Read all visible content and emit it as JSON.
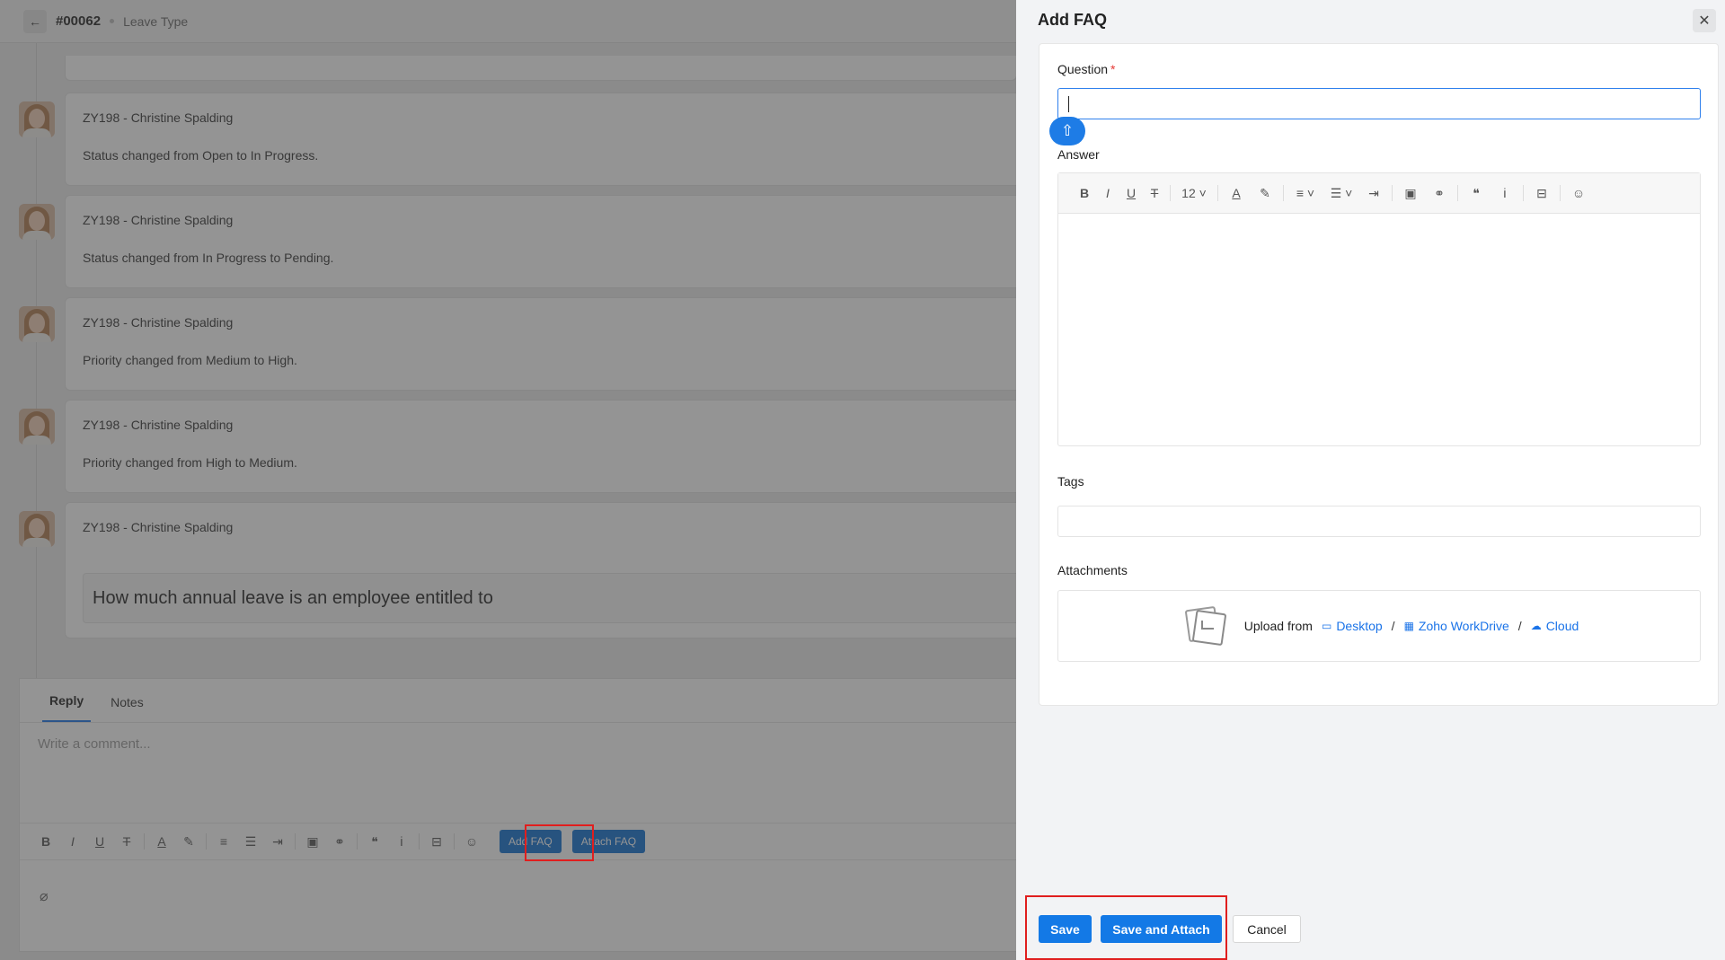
{
  "ticket": {
    "id": "#00062",
    "type": "Leave Type"
  },
  "timeline": [
    {
      "author": "ZY198 - Christine Spalding",
      "message": "Status changed from Open to In Progress."
    },
    {
      "author": "ZY198 - Christine Spalding",
      "message": "Status changed from In Progress to Pending."
    },
    {
      "author": "ZY198 - Christine Spalding",
      "message": "Priority changed from Medium to High."
    },
    {
      "author": "ZY198 - Christine Spalding",
      "message": "Priority changed from High to Medium."
    },
    {
      "author": "ZY198 - Christine Spalding",
      "faq": "How much annual leave is an employee entitled to"
    }
  ],
  "reply": {
    "tabs": [
      "Reply",
      "Notes"
    ],
    "active_tab": "Reply",
    "placeholder": "Write a comment...",
    "add_faq_label": "Add FAQ",
    "attach_faq_label": "Attach FAQ"
  },
  "drawer": {
    "title": "Add FAQ",
    "question_label": "Question",
    "required_marker": "*",
    "question_value": "",
    "answer_label": "Answer",
    "font_size": "12",
    "tags_label": "Tags",
    "attachments_label": "Attachments",
    "upload_from": "Upload from",
    "sources": [
      "Desktop",
      "Zoho WorkDrive",
      "Cloud"
    ],
    "separator": "/"
  },
  "footer": {
    "save": "Save",
    "save_attach": "Save and Attach",
    "cancel": "Cancel"
  },
  "colors": {
    "accent": "#1379e6",
    "highlight": "#e01e1e",
    "overlay": "#3c3c3c"
  },
  "icons": {
    "bold": "B",
    "italic": "I",
    "underline": "U",
    "strike": "T",
    "back": "←",
    "close": "✕",
    "scroll_top": "⇧",
    "clip": "🖇"
  }
}
